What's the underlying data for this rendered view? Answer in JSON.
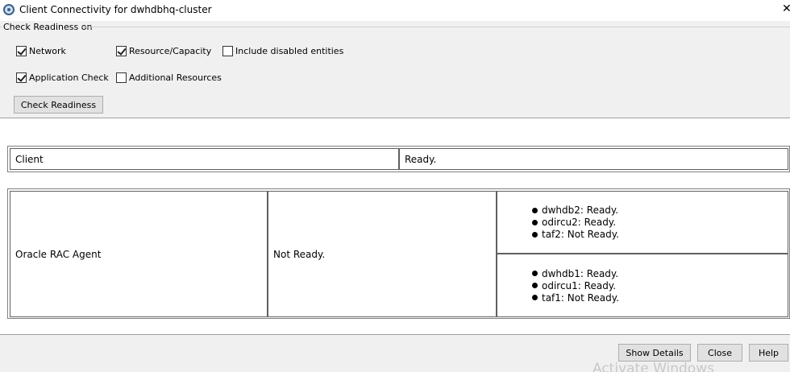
{
  "window": {
    "title": "Client Connectivity for dwhdbhq-cluster",
    "close_glyph": "✕"
  },
  "readiness_group": {
    "title": "Check Readiness on",
    "options": [
      {
        "label": "Network",
        "checked": true
      },
      {
        "label": "Resource/Capacity",
        "checked": true
      },
      {
        "label": "Include disabled entities",
        "checked": false
      },
      {
        "label": "Application Check",
        "checked": true
      },
      {
        "label": "Additional Resources",
        "checked": false
      }
    ],
    "check_button": "Check Readiness"
  },
  "client_table": {
    "name": "Client",
    "status": "Ready."
  },
  "agent_table": {
    "name": "Oracle RAC Agent",
    "status": "Not Ready.",
    "nodes": [
      {
        "items": [
          "dwhdb2: Ready.",
          "odircu2: Ready.",
          "taf2: Not Ready."
        ]
      },
      {
        "items": [
          "dwhdb1: Ready.",
          "odircu1: Ready.",
          "taf1: Not Ready."
        ]
      }
    ]
  },
  "footer": {
    "show_details": "Show Details",
    "close": "Close",
    "help": "Help",
    "watermark": "Activate Windows"
  }
}
